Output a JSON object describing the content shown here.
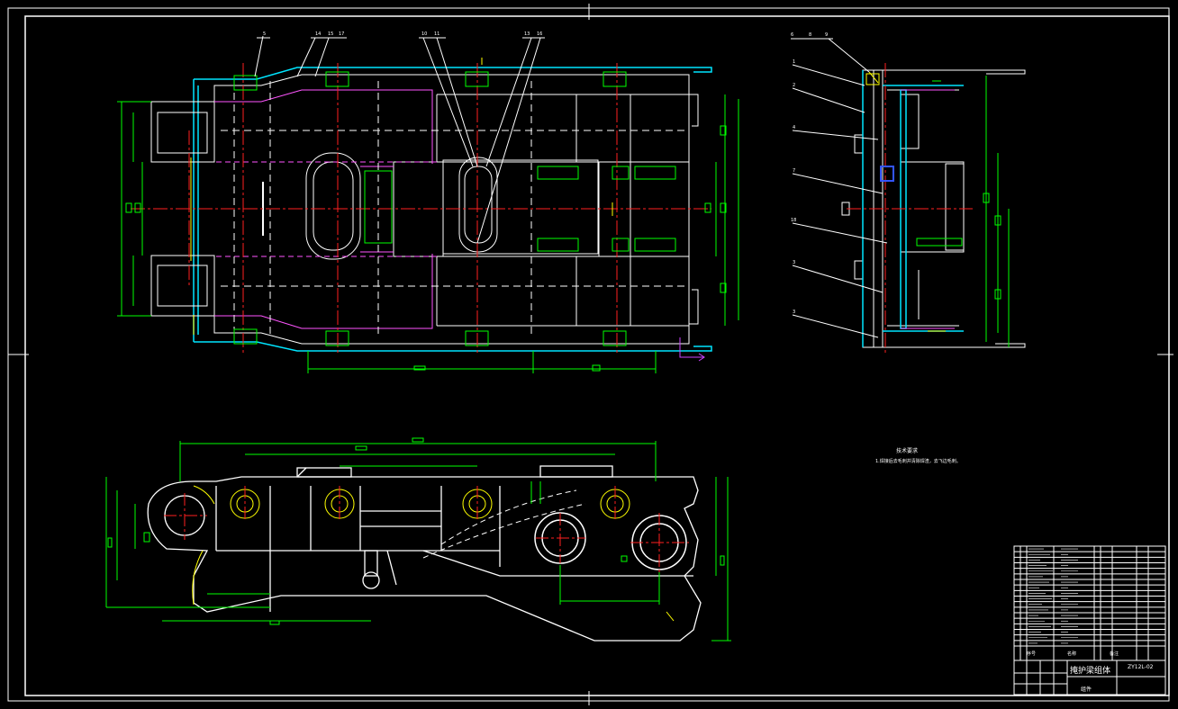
{
  "drawing": {
    "background": "#000000",
    "colors": {
      "frame": "#ffffff",
      "outline": "#ffffff",
      "dimension": "#00ff00",
      "centerline": "#ff2020",
      "hidden": "#ff55ff",
      "cover": "#00e5ff",
      "detail": "#ffff00",
      "ucs": "#cc44ff",
      "leader": "#ffffff"
    },
    "balloons": {
      "top_view": [
        "5",
        "14",
        "15",
        "17",
        "10",
        "11",
        "13",
        "16"
      ],
      "side_view": [
        "6",
        "8",
        "9",
        "1",
        "2",
        "4",
        "7",
        "18",
        "3",
        "3"
      ]
    },
    "tech_notes": {
      "heading": "技术要求",
      "line1": "1.焊接后去毛刺并清除焊渣，去飞边毛刺。"
    },
    "title_block": {
      "title": "掩护梁组体",
      "drawing_no": "ZY12L-02",
      "sub_title": "组件",
      "left_label": "序号",
      "mid_label": "名称",
      "right_label": "备注"
    }
  }
}
